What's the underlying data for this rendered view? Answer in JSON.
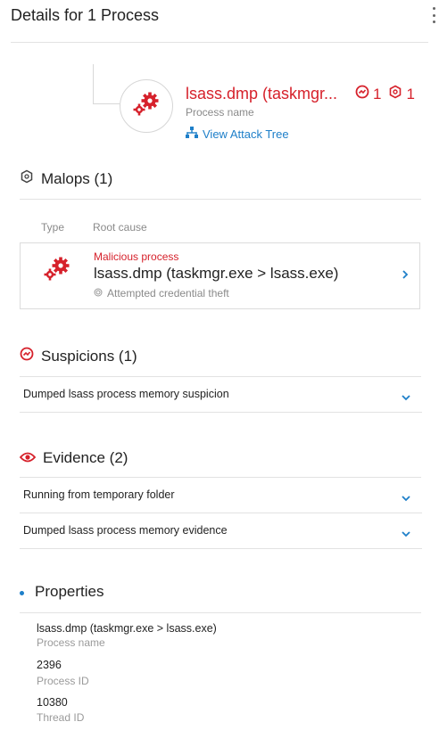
{
  "header": {
    "title": "Details for 1 Process"
  },
  "process": {
    "name": "lsass.dmp (taskmgr...",
    "suspicion_count": "1",
    "malop_count": "1",
    "subtitle": "Process name",
    "attack_tree_link": "View Attack Tree"
  },
  "malops": {
    "title": "Malops (1)",
    "col_type": "Type",
    "col_root_cause": "Root cause",
    "items": [
      {
        "kind": "Malicious process",
        "name": "lsass.dmp (taskmgr.exe > lsass.exe)",
        "description": "Attempted credential theft"
      }
    ]
  },
  "suspicions": {
    "title": "Suspicions (1)",
    "items": [
      {
        "label": "Dumped lsass process memory suspicion"
      }
    ]
  },
  "evidence": {
    "title": "Evidence (2)",
    "items": [
      {
        "label": "Running from temporary folder"
      },
      {
        "label": "Dumped lsass process memory evidence"
      }
    ]
  },
  "properties": {
    "title": "Properties",
    "items": [
      {
        "value": "lsass.dmp (taskmgr.exe > lsass.exe)",
        "label": "Process name"
      },
      {
        "value": "2396",
        "label": "Process ID"
      },
      {
        "value": "10380",
        "label": "Thread ID"
      }
    ]
  },
  "colors": {
    "accent": "#1e7fc9",
    "danger": "#d6212b",
    "muted": "#8a8a8a"
  },
  "icons": {
    "process": "gears-icon",
    "suspicion": "suspicion-gauge-icon",
    "malop": "malop-shield-icon",
    "attack_tree": "tree-icon",
    "evidence": "eye-icon",
    "chevron": "chevron-down-icon"
  }
}
